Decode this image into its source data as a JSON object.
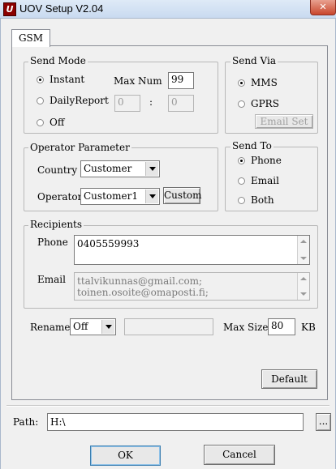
{
  "window": {
    "title": "UOV Setup V2.04",
    "icon_letter": "U",
    "close_glyph": "✕"
  },
  "tabs": [
    {
      "label": "GSM",
      "active": true
    }
  ],
  "send_mode": {
    "legend": "Send Mode",
    "options": [
      "Instant",
      "DailyReport",
      "Off"
    ],
    "selected": "Instant",
    "max_num_label": "Max Num",
    "max_num_value": "99",
    "daily_hour": "0",
    "time_separator": ":",
    "daily_minute": "0"
  },
  "send_via": {
    "legend": "Send Via",
    "options": [
      "MMS",
      "GPRS"
    ],
    "selected": "MMS",
    "email_set_label": "Email Set"
  },
  "operator_parameter": {
    "legend": "Operator Parameter",
    "country_label": "Country",
    "country_value": "Customer",
    "operator_label": "Operator",
    "operator_value": "Customer1",
    "custom_button": "Custom"
  },
  "send_to": {
    "legend": "Send To",
    "options": [
      "Phone",
      "Email",
      "Both"
    ],
    "selected": "Phone"
  },
  "recipients": {
    "legend": "Recipients",
    "phone_label": "Phone",
    "phone_value": "0405559993",
    "email_label": "Email",
    "email_lines": [
      "ttalvikunnas@gmail.com;",
      "toinen.osoite@omaposti.fi;"
    ]
  },
  "rename": {
    "label": "Rename",
    "value": "Off"
  },
  "max_size": {
    "label": "Max Size",
    "value": "80",
    "unit": "KB"
  },
  "default_button": "Default",
  "path": {
    "label": "Path:",
    "value": "H:\\",
    "browse_label": "..."
  },
  "ok_button": "OK",
  "cancel_button": "Cancel"
}
